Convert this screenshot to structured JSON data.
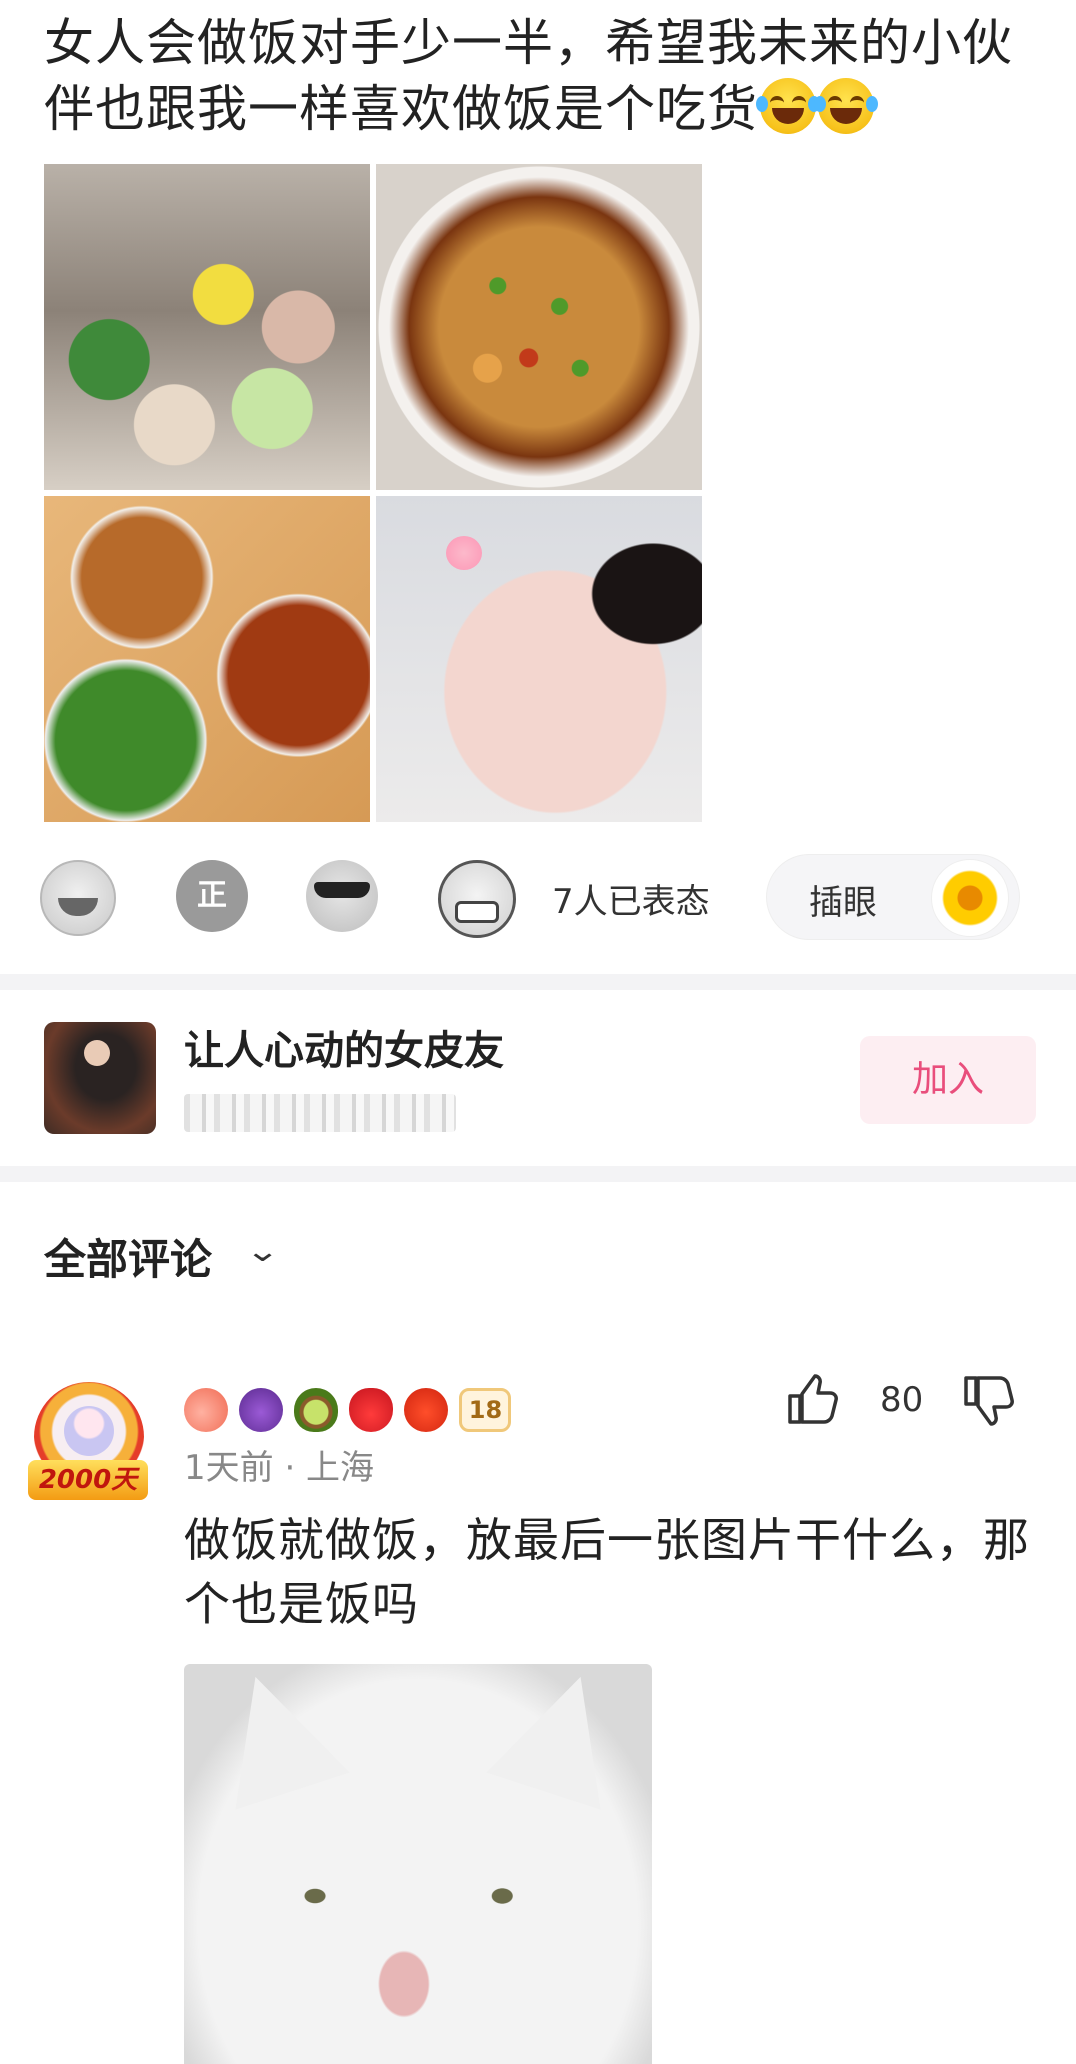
{
  "post": {
    "text": "女人会做饭对手少一半，希望我未来的小伙伴也跟我一样喜欢做饭是个吃货",
    "trailing_emojis": [
      "laughing-tears",
      "laughing-tears"
    ]
  },
  "photos": [
    "ingredients-prep",
    "spicy-chicken-dish",
    "table-of-dishes",
    "person-in-pink-nightdress"
  ],
  "reactions": {
    "icons": [
      "laugh-icon",
      "zheng-icon",
      "sunglasses-icon",
      "grin-icon"
    ],
    "zheng_label": "正",
    "count_label": "7人已表态",
    "poke_label": "插眼",
    "poke_icon": "sunflower-icon"
  },
  "group": {
    "name": "让人心动的女皮友",
    "join_label": "加入"
  },
  "comments_header": {
    "title": "全部评论",
    "chevron": "⌄"
  },
  "comment": {
    "avatar_badge": "2000天",
    "badges": [
      "peach",
      "grape",
      "avocado",
      "strawberry",
      "tomato"
    ],
    "level": "18",
    "meta": "1天前 · 上海",
    "likes": "80",
    "text": "做饭就做饭，放最后一张图片干什么，那个也是饭吗",
    "image": "white-cat-meme"
  },
  "colors": {
    "accent_pink": "#e94e7c",
    "join_bg": "#fdeef2",
    "divider": "#f3f3f5",
    "muted_text": "#888888"
  }
}
